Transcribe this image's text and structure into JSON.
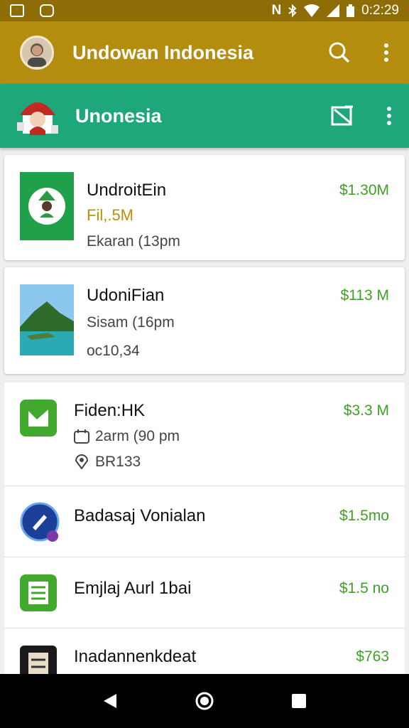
{
  "status_bar": {
    "time": "0:2:29"
  },
  "app_bar": {
    "title": "Undowan Indonesia"
  },
  "sub_bar": {
    "title": "Unonesia"
  },
  "items": [
    {
      "title": "UndroitEin",
      "line1": "Fil,.5M",
      "line2": "Ekaran (13pm",
      "price": "$1.30M"
    },
    {
      "title": "UdoniFian",
      "line1": "Sisam (16pm",
      "line2": "oc10,34",
      "price": "$113 M"
    },
    {
      "title": "Fiden:HK",
      "line1": "2arm (90 pm",
      "line2": "BR133",
      "price": "$3.3 M"
    },
    {
      "title": "Badasaj Vonialan",
      "price": "$1.5mo"
    },
    {
      "title": "Emjlaj Aurl 1bai",
      "price": "$1.5 no"
    },
    {
      "title": "Inadannenkdeat",
      "price": "$763"
    }
  ],
  "colors": {
    "status_bar": "#8e6d06",
    "app_bar": "#b48d0e",
    "sub_bar": "#1ea77a",
    "price": "#3fa126"
  }
}
